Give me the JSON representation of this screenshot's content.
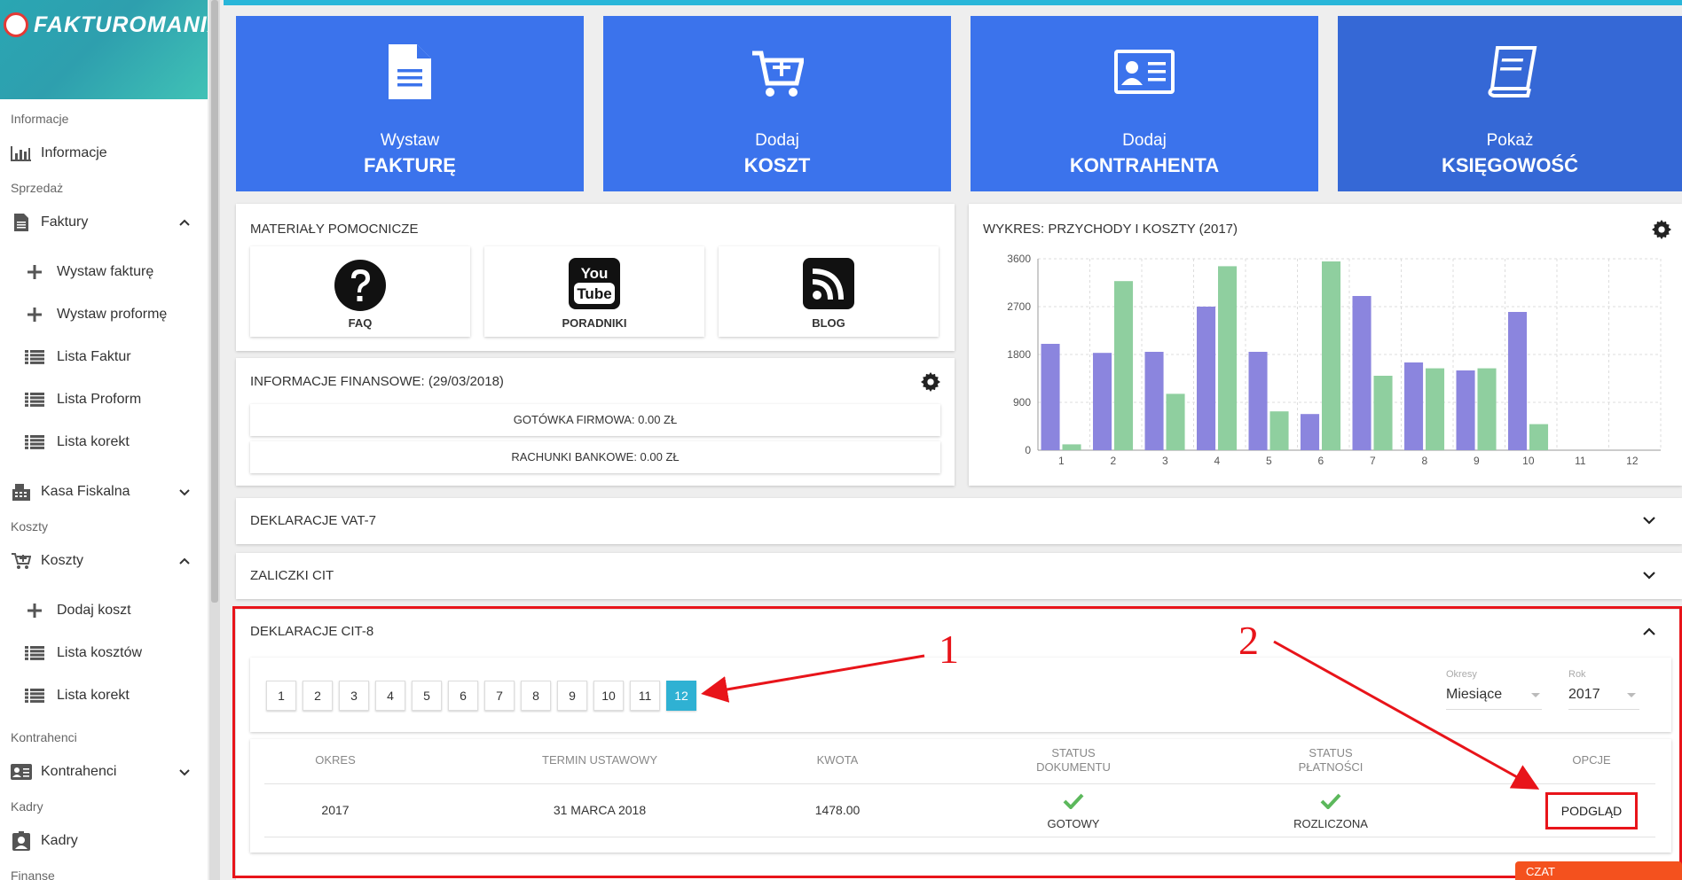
{
  "app": {
    "logo_text": "FAKTUROMANIA"
  },
  "sidebar": {
    "sections": {
      "informacje": "Informacje",
      "sprzedaz": "Sprzedaż",
      "koszty": "Koszty",
      "kontrahenci": "Kontrahenci",
      "kadry": "Kadry",
      "finanse": "Finanse"
    },
    "items": {
      "informacje": "Informacje",
      "faktury": "Faktury",
      "wystaw_fakture": "Wystaw fakturę",
      "wystaw_proforme": "Wystaw proformę",
      "lista_faktur": "Lista Faktur",
      "lista_proform": "Lista Proform",
      "lista_korekt": "Lista korekt",
      "kasa_fiskalna": "Kasa Fiskalna",
      "koszty": "Koszty",
      "dodaj_koszt": "Dodaj koszt",
      "lista_kosztow": "Lista kosztów",
      "lista_korekt_2": "Lista korekt",
      "kontrahenci": "Kontrahenci",
      "kadry": "Kadry"
    }
  },
  "tiles": [
    {
      "line1": "Wystaw",
      "line2": "FAKTURĘ",
      "icon": "document-icon"
    },
    {
      "line1": "Dodaj",
      "line2": "KOSZT",
      "icon": "cart-plus-icon"
    },
    {
      "line1": "Dodaj",
      "line2": "KONTRAHENTA",
      "icon": "id-card-icon"
    },
    {
      "line1": "Pokaż",
      "line2": "KSIĘGOWOŚĆ",
      "icon": "book-icon"
    }
  ],
  "materials": {
    "title": "MATERIAŁY POMOCNICZE",
    "items": [
      {
        "label": "FAQ",
        "icon": "question-icon"
      },
      {
        "label": "PORADNIKI",
        "icon": "youtube-icon",
        "icon_text_1": "You",
        "icon_text_2": "Tube"
      },
      {
        "label": "BLOG",
        "icon": "rss-icon"
      }
    ]
  },
  "finance": {
    "title": "INFORMACJE FINANSOWE: (29/03/2018)",
    "rows": [
      "GOTÓWKA FIRMOWA: 0.00 ZŁ",
      "RACHUNKI BANKOWE: 0.00 ZŁ"
    ]
  },
  "chart_card": {
    "title": "WYKRES: PRZYCHODY I KOSZTY (2017)"
  },
  "chart_data": {
    "type": "bar",
    "title": "WYKRES: PRZYCHODY I KOSZTY (2017)",
    "categories": [
      "1",
      "2",
      "3",
      "4",
      "5",
      "6",
      "7",
      "8",
      "9",
      "10",
      "11",
      "12"
    ],
    "series": [
      {
        "color": "#8b85de",
        "values": [
          2000,
          1830,
          1850,
          2700,
          1850,
          680,
          2900,
          1650,
          1500,
          2600,
          0,
          0
        ]
      },
      {
        "color": "#8fcf9f",
        "values": [
          110,
          3180,
          1060,
          3460,
          730,
          3550,
          1400,
          1540,
          1540,
          490,
          0,
          0
        ]
      }
    ],
    "yticks": [
      0,
      900,
      1800,
      2700,
      3600
    ],
    "ylim": [
      0,
      3600
    ],
    "grid": true
  },
  "accordions": {
    "vat7": "DEKLARACJE VAT-7",
    "cit": "ZALICZKI CIT",
    "cit8": "DEKLARACJE CIT-8"
  },
  "pager": {
    "pages": [
      "1",
      "2",
      "3",
      "4",
      "5",
      "6",
      "7",
      "8",
      "9",
      "10",
      "11",
      "12"
    ],
    "active": "12"
  },
  "filters": {
    "okresy_label": "Okresy",
    "okresy_value": "Miesiące",
    "rok_label": "Rok",
    "rok_value": "2017"
  },
  "table": {
    "headers": {
      "okres": "OKRES",
      "termin": "TERMIN USTAWOWY",
      "kwota": "KWOTA",
      "status_dok_1": "STATUS",
      "status_dok_2": "DOKUMENTU",
      "status_plat_1": "STATUS",
      "status_plat_2": "PŁATNOŚCI",
      "opcje": "OPCJE"
    },
    "row": {
      "okres": "2017",
      "termin": "31 MARCA 2018",
      "kwota": "1478.00",
      "status_dok": "GOTOWY",
      "status_plat": "ROZLICZONA",
      "action": "PODGLĄD"
    }
  },
  "annotations": {
    "one": "1",
    "two": "2"
  },
  "chat": {
    "label": "CZAT"
  },
  "colors": {
    "tile": "#3b73ec",
    "accent": "#2fb1d3",
    "annotation": "#e8141a",
    "check": "#5cb85c"
  }
}
